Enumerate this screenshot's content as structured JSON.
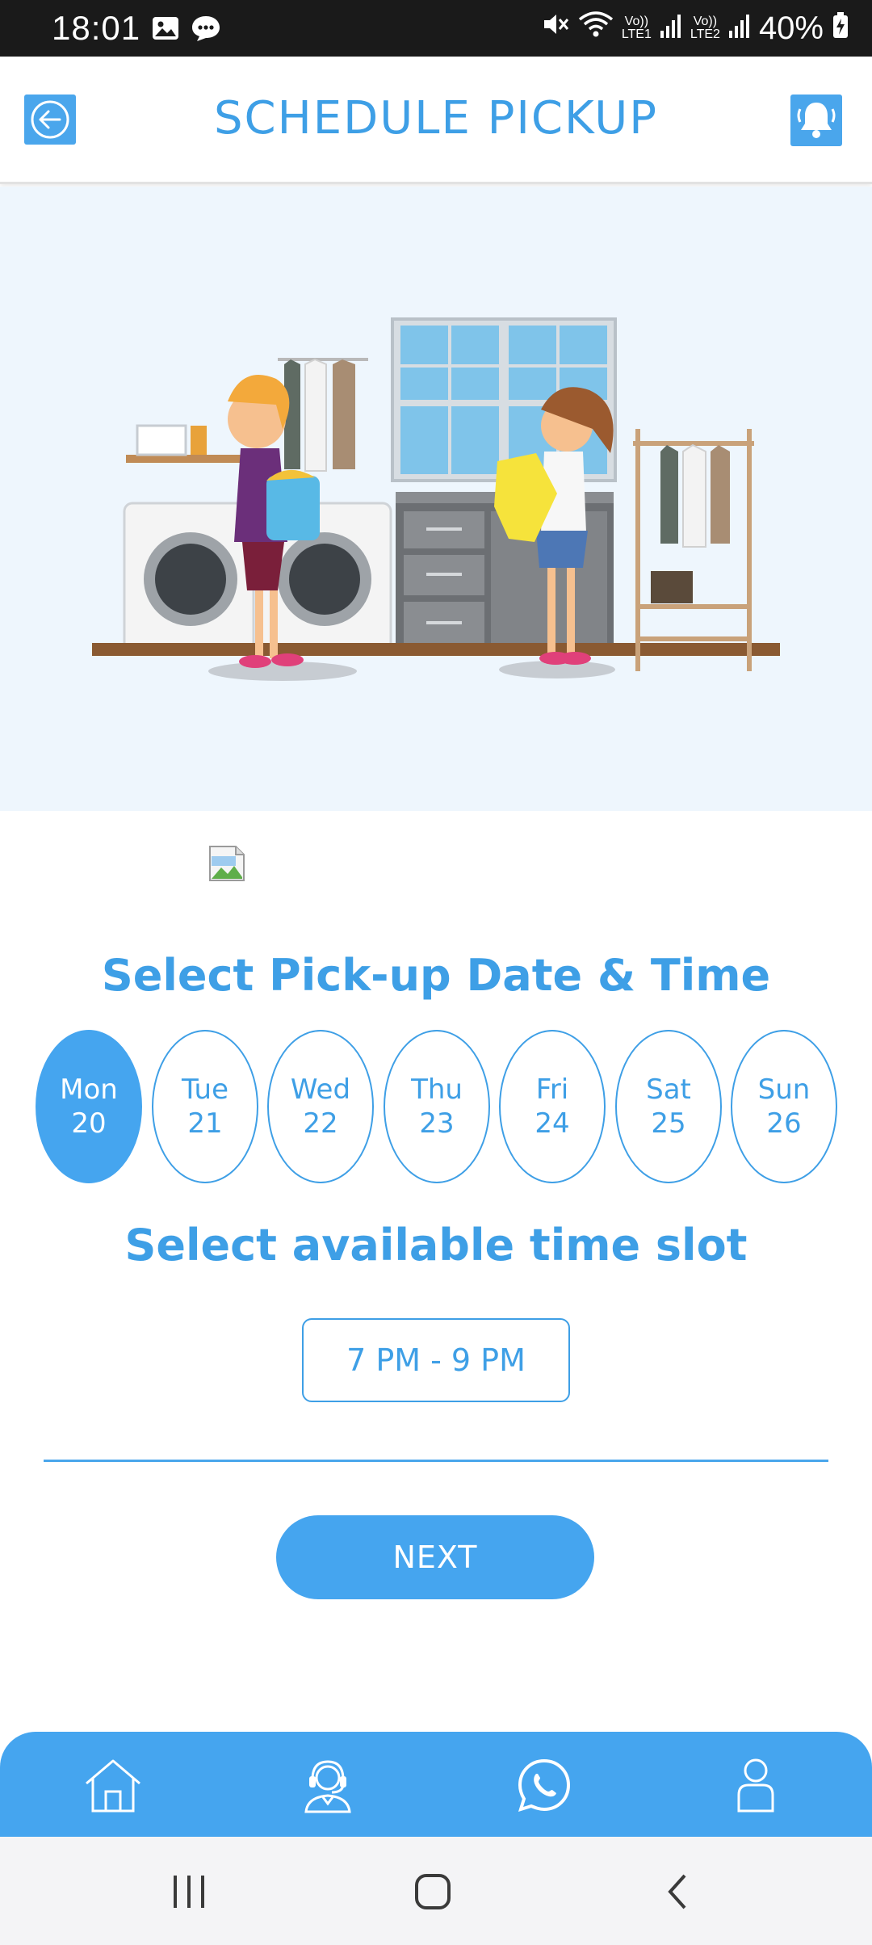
{
  "status_bar": {
    "time": "18:01",
    "sim1_label": "Vo))\nLTE1",
    "sim2_label": "Vo))\nLTE2",
    "battery": "40%",
    "icons": [
      "gallery-icon",
      "message-icon",
      "mute-icon",
      "wifi-icon",
      "signal-icon",
      "battery-charging-icon"
    ]
  },
  "header": {
    "title": "SCHEDULE PICKUP",
    "back_icon": "arrow-left-circle-icon",
    "bell_icon": "bell-icon"
  },
  "hero": {
    "illustration": "laundry-room-illustration"
  },
  "date_section": {
    "title": "Select Pick-up Date & Time",
    "days": [
      {
        "day": "Mon",
        "date": "20",
        "selected": true
      },
      {
        "day": "Tue",
        "date": "21",
        "selected": false
      },
      {
        "day": "Wed",
        "date": "22",
        "selected": false
      },
      {
        "day": "Thu",
        "date": "23",
        "selected": false
      },
      {
        "day": "Fri",
        "date": "24",
        "selected": false
      },
      {
        "day": "Sat",
        "date": "25",
        "selected": false
      },
      {
        "day": "Sun",
        "date": "26",
        "selected": false
      }
    ]
  },
  "slot_section": {
    "title": "Select available time slot",
    "slots": [
      "7 PM - 9 PM"
    ]
  },
  "next_label": "NEXT",
  "bottom_nav": {
    "items": [
      "home-icon",
      "support-agent-icon",
      "whatsapp-icon",
      "profile-icon"
    ]
  },
  "colors": {
    "accent": "#45a5ef",
    "title_text": "#3e9fe6",
    "hero_bg": "#eef6fd",
    "status_bar": "#1a1a1a"
  }
}
